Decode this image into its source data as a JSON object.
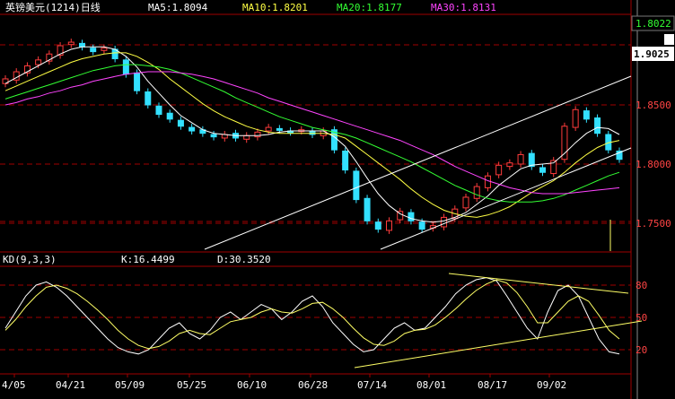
{
  "header": {
    "title": "英镑美元(1214)日线",
    "ma5_label": "MA5:1.8094",
    "ma10_label": "MA10:1.8201",
    "ma20_label": "MA20:1.8177",
    "ma30_label": "MA30:1.8131"
  },
  "price_axis": {
    "ticks": [
      "1.8500",
      "1.8000",
      "1.7500"
    ],
    "top_label": "1.8022",
    "last_price_label": "1.9025"
  },
  "kd_header": {
    "title": "KD(9,3,3)",
    "k_label": "K:16.4499",
    "d_label": "D:30.3520"
  },
  "kd_axis": {
    "ticks": [
      "80",
      "50",
      "20"
    ]
  },
  "x_axis": {
    "ticks": [
      "4/05",
      "04/21",
      "05/09",
      "05/25",
      "06/10",
      "06/28",
      "07/14",
      "08/01",
      "08/17",
      "09/02"
    ]
  },
  "colors": {
    "up": "#ff3c3c",
    "down": "#33e0ff",
    "ma5": "#ffffff",
    "ma10": "#ffff44",
    "ma20": "#33ff33",
    "ma30": "#ff44ff",
    "grid": "#a00000",
    "k": "#ffffff",
    "d": "#ffff66"
  },
  "chart_data": [
    {
      "type": "candlestick",
      "ylim": [
        1.725,
        1.825
      ],
      "x": [
        "04/05",
        "",
        "",
        "",
        "",
        "",
        "04/21",
        "",
        "",
        "",
        "",
        "",
        "05/09",
        "",
        "",
        "",
        "",
        "",
        "05/25",
        "",
        "",
        "",
        "",
        "",
        "06/10",
        "",
        "",
        "",
        "",
        "",
        "06/28",
        "",
        "",
        "",
        "",
        "",
        "07/14",
        "",
        "",
        "",
        "",
        "",
        "08/01",
        "",
        "",
        "",
        "",
        "",
        "08/17",
        "",
        "",
        "",
        "",
        "",
        "09/02",
        "",
        "",
        "",
        ""
      ],
      "close": [
        1.872,
        1.878,
        1.883,
        1.888,
        1.893,
        1.9,
        1.903,
        1.899,
        1.895,
        1.898,
        1.889,
        1.876,
        1.862,
        1.85,
        1.842,
        1.838,
        1.832,
        1.828,
        1.826,
        1.823,
        1.825,
        1.822,
        1.824,
        1.827,
        1.831,
        1.829,
        1.827,
        1.829,
        1.825,
        1.828,
        1.812,
        1.795,
        1.77,
        1.752,
        1.745,
        1.752,
        1.76,
        1.752,
        1.745,
        1.748,
        1.755,
        1.762,
        1.772,
        1.781,
        1.79,
        1.799,
        1.801,
        1.808,
        1.798,
        1.793,
        1.803,
        1.832,
        1.846,
        1.838,
        1.826,
        1.812,
        1.804
      ],
      "series": [
        {
          "name": "MA5",
          "values": [
            1.868,
            1.873,
            1.878,
            1.883,
            1.888,
            1.893,
            1.897,
            1.899,
            1.899,
            1.899,
            1.897,
            1.891,
            1.882,
            1.87,
            1.86,
            1.85,
            1.841,
            1.835,
            1.829,
            1.826,
            1.825,
            1.824,
            1.824,
            1.824,
            1.825,
            1.827,
            1.828,
            1.828,
            1.828,
            1.828,
            1.823,
            1.815,
            1.802,
            1.788,
            1.775,
            1.765,
            1.758,
            1.754,
            1.752,
            1.751,
            1.752,
            1.755,
            1.759,
            1.766,
            1.773,
            1.782,
            1.789,
            1.796,
            1.799,
            1.8,
            1.801,
            1.809,
            1.818,
            1.826,
            1.831,
            1.83,
            1.825
          ]
        },
        {
          "name": "MA10",
          "values": [
            1.862,
            1.866,
            1.87,
            1.874,
            1.878,
            1.882,
            1.886,
            1.889,
            1.891,
            1.893,
            1.894,
            1.894,
            1.891,
            1.886,
            1.88,
            1.872,
            1.865,
            1.858,
            1.851,
            1.845,
            1.84,
            1.836,
            1.832,
            1.829,
            1.827,
            1.826,
            1.826,
            1.826,
            1.826,
            1.826,
            1.825,
            1.822,
            1.815,
            1.808,
            1.801,
            1.794,
            1.787,
            1.779,
            1.772,
            1.766,
            1.761,
            1.758,
            1.756,
            1.755,
            1.757,
            1.76,
            1.764,
            1.77,
            1.776,
            1.781,
            1.786,
            1.793,
            1.801,
            1.808,
            1.814,
            1.818,
            1.82
          ]
        },
        {
          "name": "MA20",
          "values": [
            1.855,
            1.858,
            1.861,
            1.864,
            1.867,
            1.87,
            1.873,
            1.876,
            1.879,
            1.881,
            1.883,
            1.884,
            1.884,
            1.883,
            1.882,
            1.88,
            1.877,
            1.873,
            1.869,
            1.865,
            1.861,
            1.856,
            1.852,
            1.848,
            1.844,
            1.84,
            1.837,
            1.834,
            1.831,
            1.829,
            1.827,
            1.825,
            1.822,
            1.818,
            1.814,
            1.81,
            1.806,
            1.802,
            1.797,
            1.792,
            1.787,
            1.782,
            1.778,
            1.774,
            1.771,
            1.769,
            1.768,
            1.768,
            1.768,
            1.769,
            1.771,
            1.774,
            1.778,
            1.782,
            1.786,
            1.79,
            1.793
          ]
        },
        {
          "name": "MA30",
          "values": [
            1.85,
            1.852,
            1.855,
            1.857,
            1.86,
            1.862,
            1.865,
            1.867,
            1.87,
            1.872,
            1.874,
            1.876,
            1.877,
            1.878,
            1.878,
            1.878,
            1.877,
            1.876,
            1.874,
            1.872,
            1.869,
            1.866,
            1.863,
            1.86,
            1.856,
            1.853,
            1.85,
            1.847,
            1.844,
            1.841,
            1.838,
            1.835,
            1.832,
            1.829,
            1.826,
            1.823,
            1.82,
            1.816,
            1.812,
            1.808,
            1.803,
            1.798,
            1.794,
            1.79,
            1.786,
            1.783,
            1.78,
            1.778,
            1.776,
            1.775,
            1.775,
            1.775,
            1.776,
            1.777,
            1.778,
            1.779,
            1.78
          ]
        }
      ]
    },
    {
      "type": "line",
      "title": "KD(9,3,3)",
      "ylim": [
        0,
        100
      ],
      "series": [
        {
          "name": "K",
          "values": [
            40,
            55,
            70,
            80,
            83,
            78,
            70,
            60,
            50,
            40,
            30,
            22,
            18,
            16,
            20,
            30,
            40,
            45,
            35,
            30,
            38,
            50,
            55,
            48,
            55,
            62,
            58,
            48,
            55,
            65,
            70,
            60,
            45,
            35,
            25,
            18,
            20,
            30,
            40,
            45,
            38,
            40,
            50,
            60,
            72,
            80,
            85,
            87,
            84,
            70,
            55,
            40,
            30,
            55,
            75,
            80,
            70,
            50,
            30,
            18,
            16
          ]
        },
        {
          "name": "D",
          "values": [
            38,
            48,
            60,
            70,
            78,
            80,
            77,
            72,
            65,
            57,
            48,
            38,
            30,
            24,
            21,
            23,
            28,
            35,
            38,
            35,
            34,
            40,
            46,
            48,
            50,
            55,
            58,
            55,
            54,
            58,
            63,
            64,
            58,
            50,
            40,
            31,
            25,
            24,
            28,
            35,
            38,
            39,
            43,
            50,
            58,
            67,
            75,
            81,
            85,
            82,
            73,
            60,
            45,
            45,
            55,
            65,
            70,
            65,
            52,
            38,
            30
          ]
        }
      ]
    }
  ]
}
